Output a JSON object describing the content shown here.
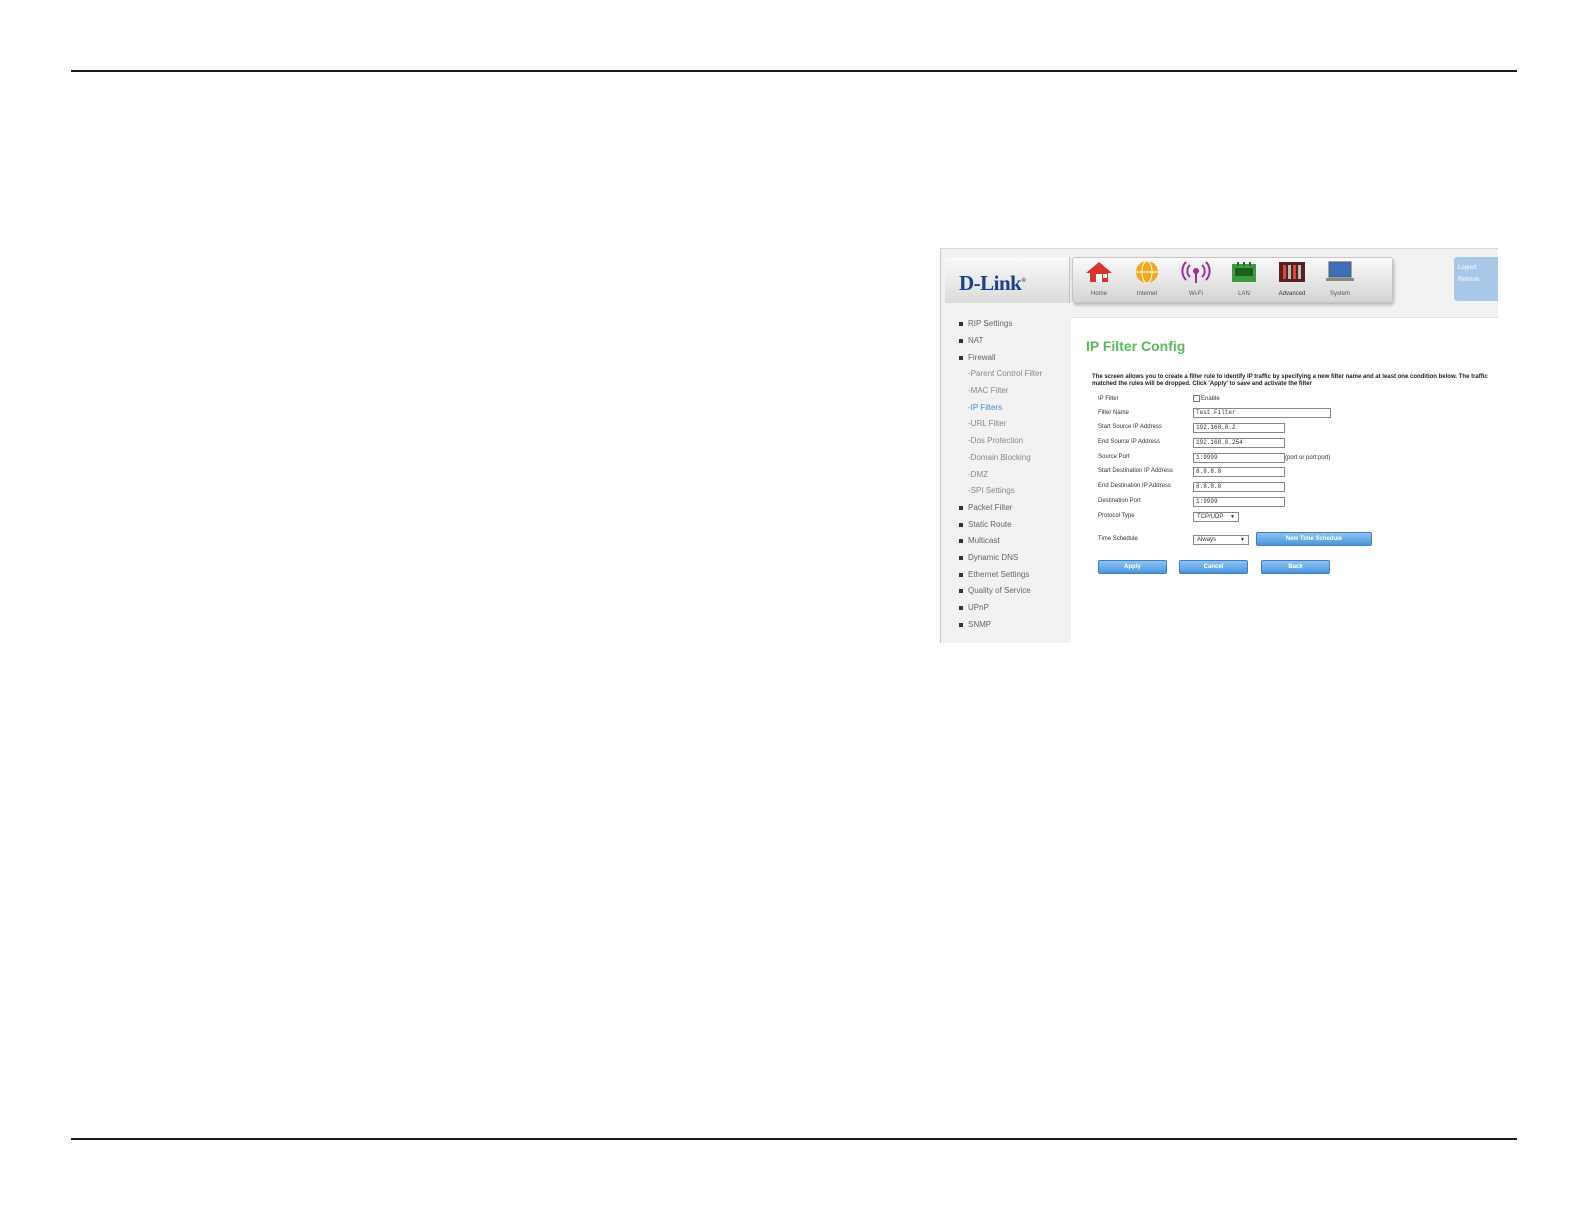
{
  "header": {
    "logo": "D-Link",
    "nav": [
      "Home",
      "Internet",
      "Wi-Fi",
      "LAN",
      "Advanced",
      "System"
    ],
    "logout": "Logout",
    "refresh": "Refresh"
  },
  "menu": {
    "items": [
      "RIP Settings",
      "NAT",
      "Firewall",
      "-Parent Control Filter",
      "-MAC Filter",
      "-IP Filters",
      "-URL Filter",
      "-Dos Protection",
      "-Domain Blocking",
      "-DMZ",
      "-SPI Settings",
      "Packet Filter",
      "Static Route",
      "Multicast",
      "Dynamic DNS",
      "Ethernet Settings",
      "Quality of Service",
      "UPnP",
      "SNMP"
    ]
  },
  "content": {
    "title": "IP Filter Config",
    "description": "The screen allows you to create a filter rule to identify IP traffic by specifying a new filter name and at least one condition below. The traffic matched the rules will be dropped. Click 'Apply' to save and activate the filter",
    "labels": {
      "ip_filter": "IP Filter",
      "filter_name": "Filter Name",
      "start_src": "Start Source IP Address",
      "end_src": "End Source IP Address",
      "src_port": "Source Port",
      "start_dst": "Start Destination IP Address",
      "end_dst": "End Destination IP Address",
      "dst_port": "Destination Port",
      "protocol": "Protocol Type",
      "schedule": "Time Schedule"
    },
    "enable_label": "Enable",
    "values": {
      "filter_name": "Test Filter",
      "start_src": "192.168.0.2",
      "end_src": "192.168.0.254",
      "src_port": "1:9999",
      "start_dst": "8.8.8.8",
      "end_dst": "8.8.8.8",
      "dst_port": "1:9999",
      "protocol": "TCP/UDP",
      "schedule": "Always"
    },
    "port_hint": "(port or port:port)",
    "buttons": {
      "new_schedule": "New Time Schedule",
      "apply": "Apply",
      "cancel": "Cancel",
      "back": "Back"
    }
  }
}
